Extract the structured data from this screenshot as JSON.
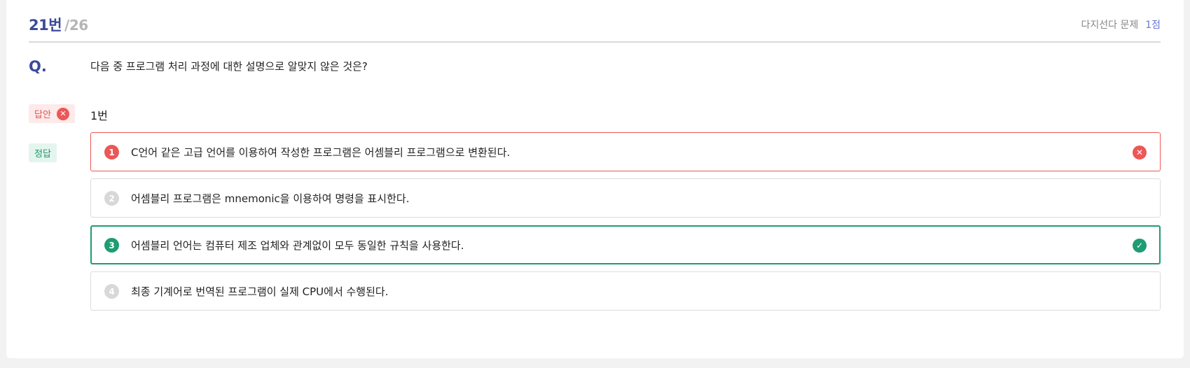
{
  "header": {
    "question_number": "21번",
    "total": "/26",
    "question_type": "다지선다 문제",
    "points": "1점"
  },
  "question": {
    "label": "Q.",
    "text": "다음 중 프로그램 처리 과정에 대한 설명으로 알맞지 않은 것은?"
  },
  "answer": {
    "tag_label": "답안",
    "value": "1번",
    "status_icon": "x-circle-icon"
  },
  "correct": {
    "tag_label": "정답"
  },
  "options": [
    {
      "number": "1",
      "text": "C언어 같은 고급 언어를 이용하여 작성한 프로그램은 어셈블리 프로그램으로 변환된다.",
      "state": "wrong"
    },
    {
      "number": "2",
      "text": "어셈블리 프로그램은 mnemonic을 이용하여 명령을 표시한다.",
      "state": "normal"
    },
    {
      "number": "3",
      "text": "어셈블리 언어는 컴퓨터 제조 업체와 관계없이 모두 동일한 규칙을 사용한다.",
      "state": "correct"
    },
    {
      "number": "4",
      "text": "최종 기계어로 번역된 프로그램이 실제 CPU에서 수행된다.",
      "state": "normal"
    }
  ],
  "colors": {
    "accent": "#3b4a9a",
    "wrong": "#ec5757",
    "correct": "#1f9c74"
  }
}
